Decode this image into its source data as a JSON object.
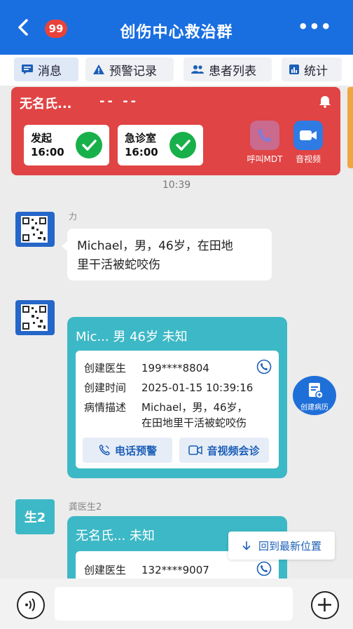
{
  "header": {
    "back_glyph": "<",
    "badge": "99",
    "title": "创伤中心救治群",
    "more": "•••"
  },
  "tabs": [
    {
      "label": "消息",
      "icon": "message-icon"
    },
    {
      "label": "预警记录",
      "icon": "warning-icon"
    },
    {
      "label": "患者列表",
      "icon": "people-icon"
    },
    {
      "label": "统计",
      "icon": "bar-chart-icon"
    }
  ],
  "alert_card": {
    "name": "无名氏...",
    "dashes": "-- --",
    "steps": [
      {
        "label": "发起",
        "time": "16:00"
      },
      {
        "label": "急诊室",
        "time": "16:00"
      }
    ],
    "actions": [
      {
        "label": "呼叫MDT"
      },
      {
        "label": "音视频"
      }
    ]
  },
  "timestamp": "10:39",
  "messages": {
    "first": {
      "sender": "力",
      "text_line1": "Michael，男，46岁，在田地",
      "text_line2": "里干活被蛇咬伤"
    },
    "case1": {
      "title": "Mic... 男 46岁 未知",
      "rows": [
        {
          "k": "创建医生",
          "v": "199****8804"
        },
        {
          "k": "创建时间",
          "v": "2025-01-15 10:39:16"
        },
        {
          "k": "病情描述",
          "v": "Michael，男，46岁，",
          "v2": "在田地里干活被蛇咬伤"
        }
      ],
      "btn_phone": "电话预警",
      "btn_video": "音视频会诊"
    },
    "second_sender_avatar": "生2",
    "second_sender": "龚医生2",
    "case2": {
      "title": "无名氏...  未知",
      "row_k": "创建医生",
      "row_v": "132****9007"
    }
  },
  "fab": {
    "label": "创建病历"
  },
  "jump": {
    "label": "回到最新位置"
  },
  "colors": {
    "header": "#1a6fe0",
    "alert": "#e04444",
    "card": "#3db8c6",
    "ok": "#18b04a"
  }
}
